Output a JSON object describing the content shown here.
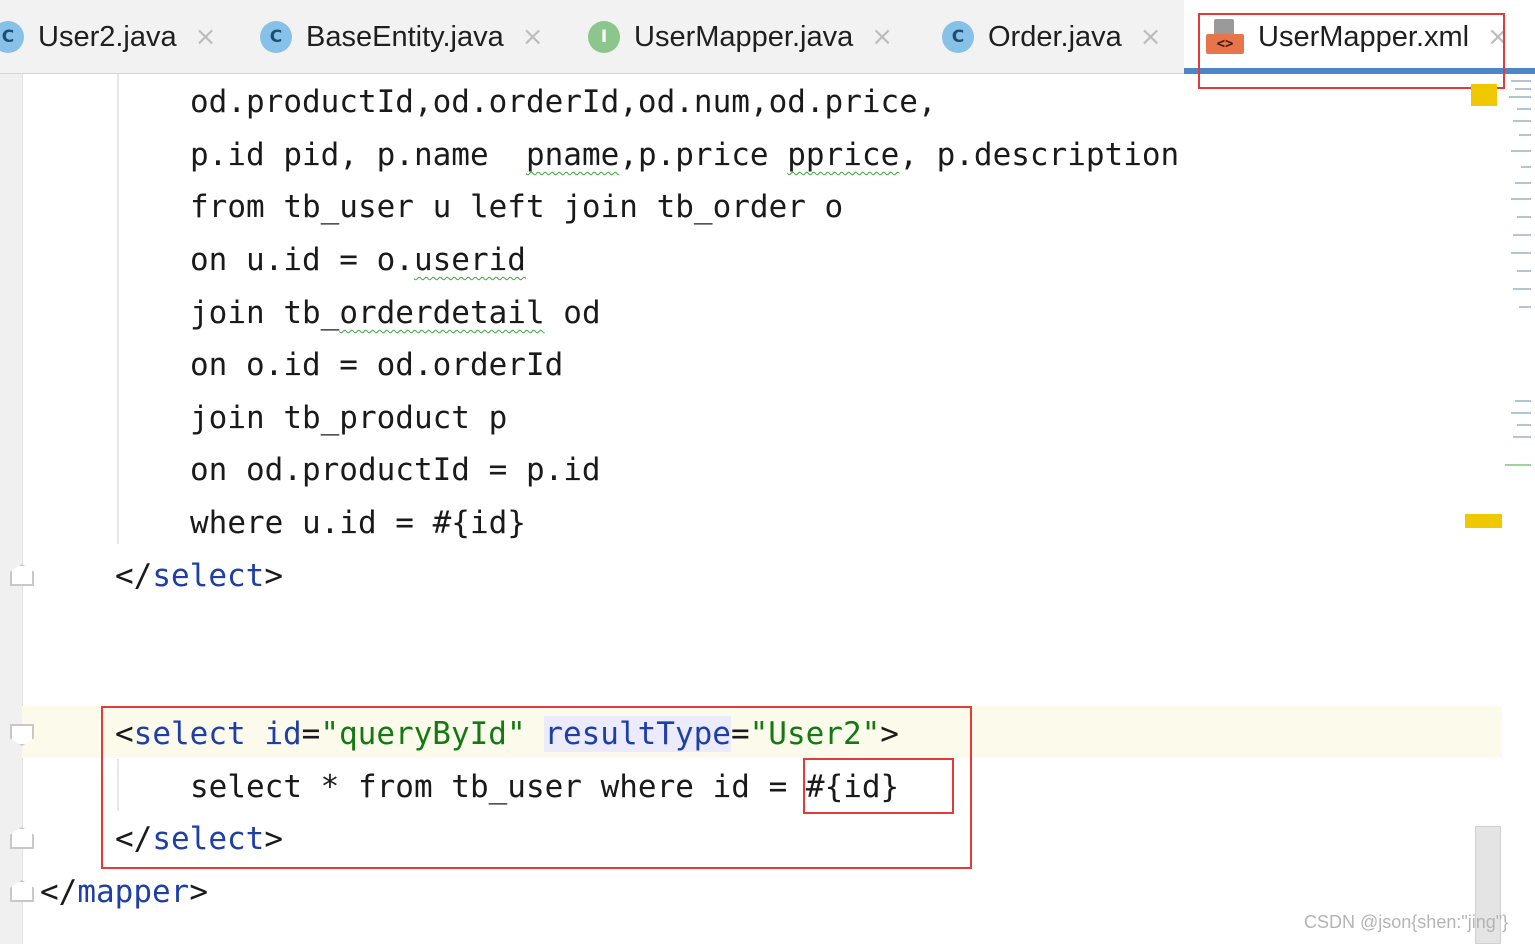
{
  "tabs": [
    {
      "label": "User2.java",
      "type_letter": "C",
      "icon": "class-icon"
    },
    {
      "label": "BaseEntity.java",
      "type_letter": "C",
      "icon": "class-icon"
    },
    {
      "label": "UserMapper.java",
      "type_letter": "I",
      "icon": "interface-icon"
    },
    {
      "label": "Order.java",
      "type_letter": "C",
      "icon": "class-icon"
    },
    {
      "label": "UserMapper.xml",
      "icon": "xml-file-icon",
      "badge": "<>",
      "active": true
    }
  ],
  "close_glyph": "×",
  "code": {
    "line1": "od.productId,od.orderId,od.num,od.price,",
    "line2_a": "p.id pid, p.name  ",
    "line2_b": "pname",
    "line2_c": ",p.price ",
    "line2_d": "pprice",
    "line2_e": ", p.description",
    "line3": "from tb_user u left join tb_order o",
    "line4_a": "on u.id = o.",
    "line4_b": "userid",
    "line5_a": "join tb_",
    "line5_b": "orderdetail",
    "line5_c": " od",
    "line6": "on o.id = od.orderId",
    "line7": "join tb_product p",
    "line8": "on od.productId = p.id",
    "line9": "where u.id = #{id}",
    "close_select_1_open": "</",
    "close_select_1_name": "select",
    "close_select_1_end": ">",
    "select_open": "<",
    "select_tag": "select",
    "attr_id_name": "id",
    "attr_id_eq": "=",
    "attr_id_val": "\"queryById\"",
    "attr_rt_name": "resultType",
    "attr_rt_eq": "=",
    "attr_rt_val": "\"User2\"",
    "select_gt": ">",
    "sql_line": "select * from tb_user where id = ",
    "sql_param": "#{id}",
    "close_select_2_open": "</",
    "close_select_2_name": "select",
    "close_select_2_end": ">",
    "close_mapper_open": "</",
    "close_mapper_name": "mapper",
    "close_mapper_end": ">"
  },
  "watermark": "CSDN @json{shen:\"jing\"}",
  "colors": {
    "tag": "#1f3fa8",
    "attr_value": "#137a13",
    "highlight_box": "#e33a3a",
    "active_tab_underline": "#4a86c8",
    "warning_marker": "#f0c800"
  }
}
